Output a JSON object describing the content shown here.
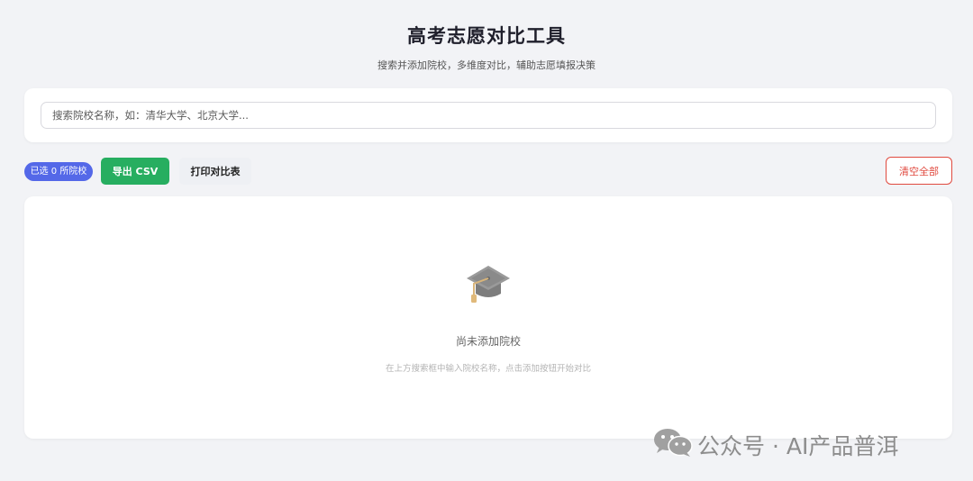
{
  "header": {
    "title": "高考志愿对比工具",
    "subtitle": "搜索并添加院校，多维度对比，辅助志愿填报决策"
  },
  "search": {
    "placeholder": "搜索院校名称，如：清华大学、北京大学...",
    "value": ""
  },
  "toolbar": {
    "selected_badge": "已选 0 所院校",
    "export_label": "导出 CSV",
    "print_label": "打印对比表",
    "clear_label": "清空全部"
  },
  "empty_state": {
    "icon": "graduation-cap-icon",
    "title": "尚未添加院校",
    "description": "在上方搜索框中输入院校名称，点击添加按钮开始对比"
  },
  "watermark": {
    "icon": "wechat-icon",
    "text": "公众号 · AI产品普洱"
  },
  "colors": {
    "background": "#f2f3f6",
    "badge": "#5468e8",
    "export": "#27ae60",
    "clear": "#e04a3f"
  }
}
